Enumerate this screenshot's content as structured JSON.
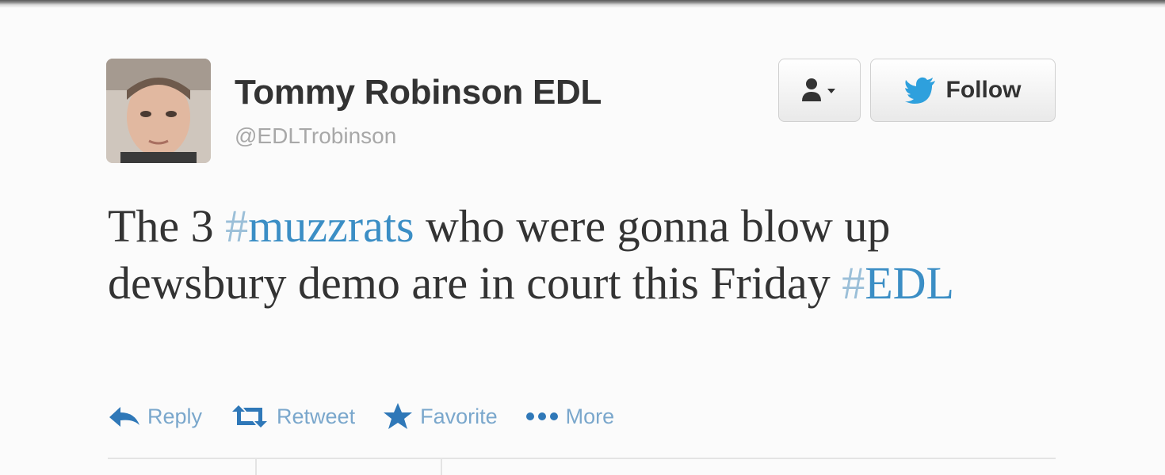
{
  "tweet": {
    "display_name": "Tommy Robinson EDL",
    "handle": "@EDLTrobinson",
    "text": {
      "part1": "The 3 ",
      "hashtag1_mark": "#",
      "hashtag1_word": "muzzrats",
      "part2": " who were gonna blow up dewsbury demo are in court this Friday ",
      "hashtag2_mark": "#",
      "hashtag2_word": "EDL"
    }
  },
  "buttons": {
    "user_menu_icon": "user-dropdown-icon",
    "follow_icon": "twitter-bird-icon",
    "follow_label": "Follow"
  },
  "actions": [
    {
      "icon": "reply-arrow-icon",
      "label": "Reply"
    },
    {
      "icon": "retweet-icon",
      "label": "Retweet"
    },
    {
      "icon": "star-icon",
      "label": "Favorite"
    },
    {
      "icon": "more-dots-icon",
      "label": "More"
    }
  ],
  "colors": {
    "link": "#3b8ec5",
    "action": "#7aa7cc",
    "text": "#333333",
    "muted": "#a8a8a8"
  }
}
